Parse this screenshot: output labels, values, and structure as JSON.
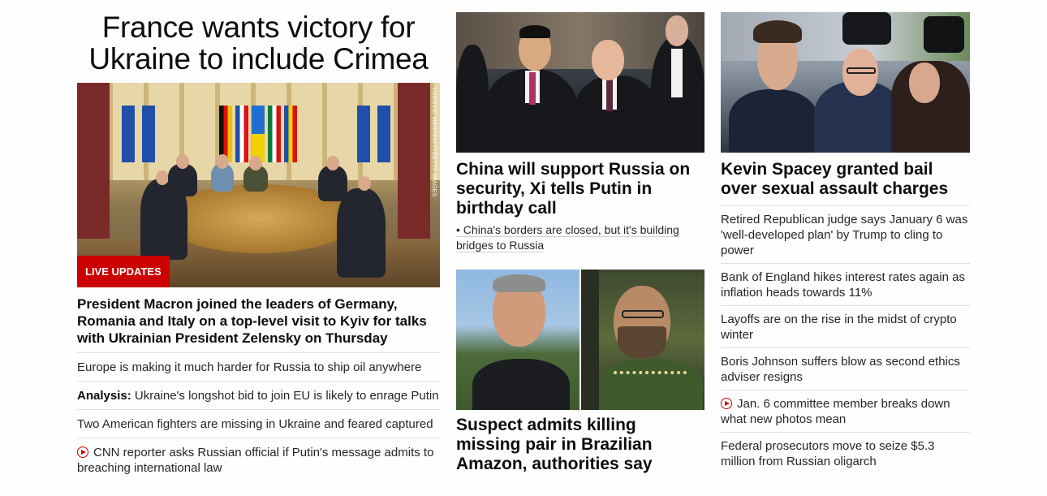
{
  "lead": {
    "headline": "France wants victory for Ukraine to include Crimea",
    "photo_credit": "LUDOVIC MARIN/AFP/GETTY IMAGES",
    "badge": "LIVE UPDATES",
    "caption": "President Macron joined the leaders of Germany, Romania and Italy on a top-level visit to Kyiv for talks with Ukrainian President Zelensky on Thursday",
    "links": [
      {
        "prefix": "",
        "text": "Europe is making it much harder for Russia to ship oil anywhere",
        "video": false
      },
      {
        "prefix": "Analysis:",
        "text": " Ukraine's longshot bid to join EU is likely to enrage Putin",
        "video": false
      },
      {
        "prefix": "",
        "text": "Two American fighters are missing in Ukraine and feared captured",
        "video": false
      },
      {
        "prefix": "",
        "text": "CNN reporter asks Russian official if Putin's message admits to breaching international law",
        "video": true
      }
    ]
  },
  "middle": {
    "story1": {
      "headline": "China will support Russia on security, Xi tells Putin in birthday call",
      "bullet": "• China's borders are closed, but it's building bridges to Russia"
    },
    "story2": {
      "headline": "Suspect admits killing missing pair in Brazilian Amazon, authorities say"
    }
  },
  "right": {
    "headline": "Kevin Spacey granted bail over sexual assault charges",
    "links": [
      {
        "text": "Retired Republican judge says January 6 was 'well-developed plan' by Trump to cling to power",
        "video": false
      },
      {
        "text": "Bank of England hikes interest rates again as inflation heads towards 11%",
        "video": false
      },
      {
        "text": "Layoffs are on the rise in the midst of crypto winter",
        "video": false
      },
      {
        "text": "Boris Johnson suffers blow as second ethics adviser resigns",
        "video": false
      },
      {
        "text": "Jan. 6 committee member breaks down what new photos mean",
        "video": true
      },
      {
        "text": "Federal prosecutors move to seize $5.3 million from Russian oligarch",
        "video": false
      }
    ]
  },
  "colors": {
    "accent": "#cc0000",
    "text": "#0c0c0c",
    "divider": "#e0e0e0"
  }
}
